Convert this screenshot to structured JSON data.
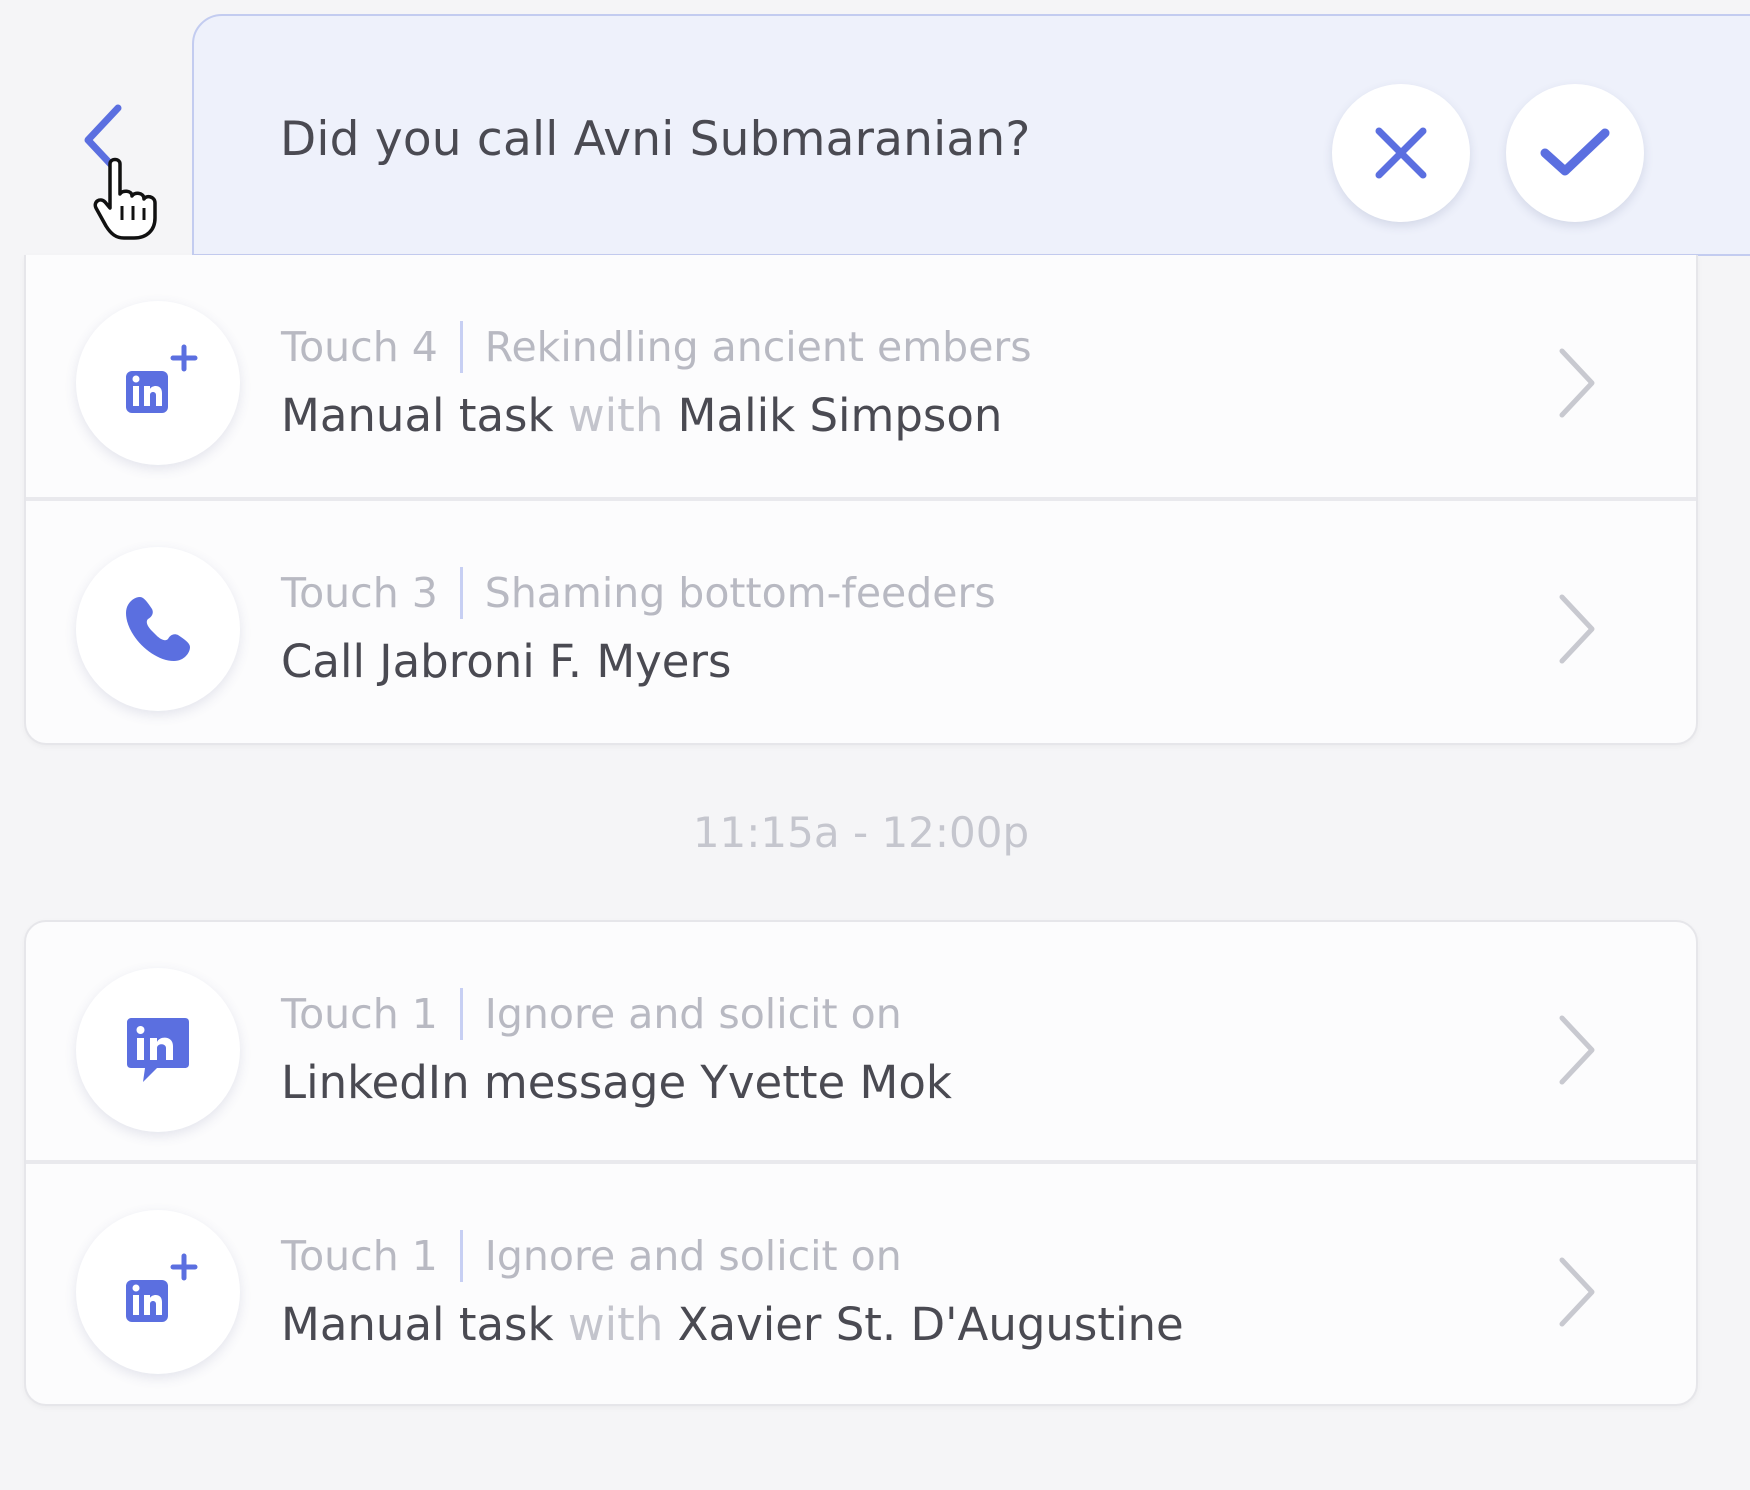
{
  "prompt": {
    "question": "Did you call Avni Submaranian?"
  },
  "colors": {
    "accent": "#5b6fe0",
    "text": "#4a4a52",
    "muted": "#b8b9c2"
  },
  "groups": [
    {
      "time": "",
      "tasks": [
        {
          "icon": "linkedin-add-icon",
          "touch": "Touch 4",
          "campaign": "Rekindling ancient embers",
          "action": "Manual task",
          "connector": "with",
          "contact": "Malik Simpson"
        },
        {
          "icon": "phone-icon",
          "touch": "Touch 3",
          "campaign": "Shaming bottom-feeders",
          "action": "Call Jabroni F. Myers"
        }
      ]
    },
    {
      "time": "11:15a - 12:00p",
      "tasks": [
        {
          "icon": "linkedin-message-icon",
          "touch": "Touch 1",
          "campaign": "Ignore and solicit on",
          "action": "LinkedIn message Yvette Mok"
        },
        {
          "icon": "linkedin-add-icon",
          "touch": "Touch 1",
          "campaign": "Ignore and solicit on",
          "action": "Manual task",
          "connector": "with",
          "contact": "Xavier St. D'Augustine"
        }
      ]
    }
  ]
}
